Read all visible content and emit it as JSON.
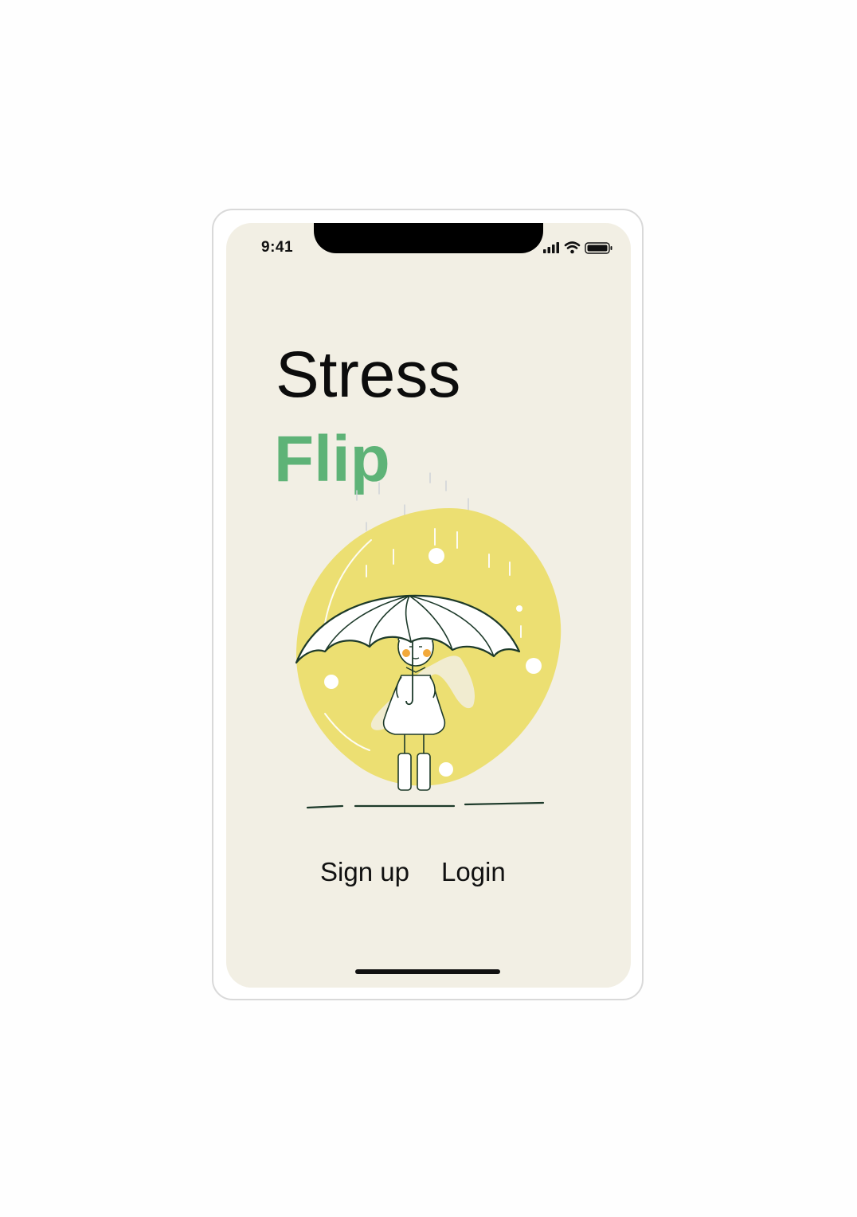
{
  "status_bar": {
    "time": "9:41",
    "icons": [
      "signal-icon",
      "wifi-icon",
      "battery-icon"
    ]
  },
  "app": {
    "title_line1": "Stress",
    "title_line2": "Flip",
    "accent_color": "#5eb377",
    "background_color": "#f2efe4",
    "illustration": "girl-with-umbrella-in-rain"
  },
  "actions": {
    "signup_label": "Sign up",
    "login_label": "Login"
  }
}
